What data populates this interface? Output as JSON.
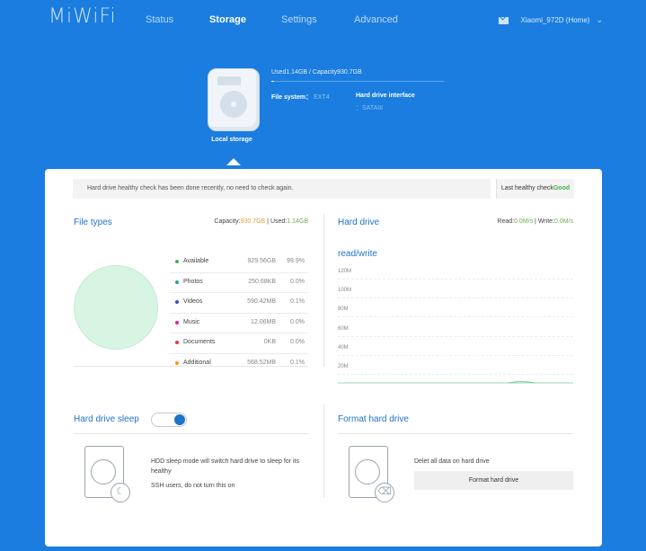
{
  "brand": {
    "logo": "MiWiFi",
    "accent": "#1b7de0"
  },
  "nav": {
    "status": "Status",
    "storage": "Storage",
    "settings": "Settings",
    "advanced": "Advanced"
  },
  "account": {
    "name": "Xiaomi_972D (Home)"
  },
  "storage_summary": {
    "caption": "Local storage",
    "usage": "Used1.14GB / Capacity930.7GB",
    "file_system_label": "File system：",
    "file_system_value": "EXT4",
    "interface_label": "Hard drive interface",
    "interface_value": "：SATAIII"
  },
  "health": {
    "message": "Hard drive healthy check has been done recently, no need to check again.",
    "status_label": "Last healthy check",
    "status_value": "Good"
  },
  "file_types": {
    "title": "File types",
    "capacity_label": "Capacity:",
    "capacity_value": "930.7GB",
    "separator": " | ",
    "used_label": "Used:",
    "used_value": "1.14GB",
    "rows": [
      {
        "name": "Available",
        "size": "929.56GB",
        "pct": "99.9%",
        "color": "#4caf50"
      },
      {
        "name": "Photos",
        "size": "250.68KB",
        "pct": "0.0%",
        "color": "#26a69a"
      },
      {
        "name": "Videos",
        "size": "590.42MB",
        "pct": "0.1%",
        "color": "#3f51b5"
      },
      {
        "name": "Music",
        "size": "12.06MB",
        "pct": "0.0%",
        "color": "#e91e8c"
      },
      {
        "name": "Documents",
        "size": "0KB",
        "pct": "0.0%",
        "color": "#e53935"
      },
      {
        "name": "Additional",
        "size": "568.52MB",
        "pct": "0.1%",
        "color": "#ff9800"
      }
    ]
  },
  "hard_drive": {
    "title": "Hard drive",
    "read_label": "Read:",
    "read_value": "0.0M/s",
    "separator": " | ",
    "write_label": "Write:",
    "write_value": "0.0M/s",
    "chart_title": "read/write",
    "axis_labels": [
      "120M",
      "100M",
      "80M",
      "60M",
      "40M",
      "20M"
    ]
  },
  "sleep": {
    "title": "Hard drive sleep",
    "enabled": true,
    "desc1": "HDD sleep mode will switch hard drive to sleep for its healthy",
    "desc2": "SSH users, do not turn this on"
  },
  "format": {
    "title": "Format hard drive",
    "desc": "Delet all data on hard drive",
    "button": "Format hard drive"
  }
}
